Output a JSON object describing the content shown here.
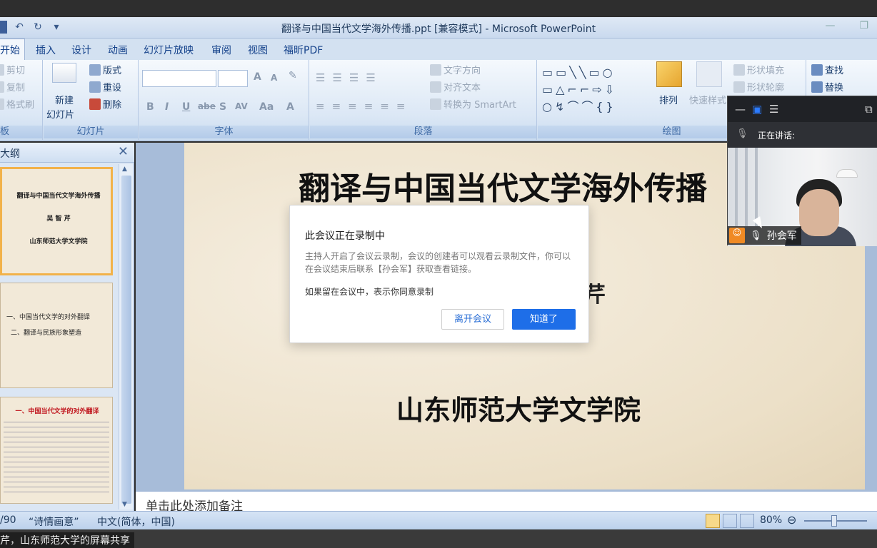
{
  "window": {
    "title": "翻译与中国当代文学海外传播.ppt [兼容模式] - Microsoft PowerPoint"
  },
  "tabs": [
    {
      "label": "开始",
      "active": true
    },
    {
      "label": "插入"
    },
    {
      "label": "设计"
    },
    {
      "label": "动画"
    },
    {
      "label": "幻灯片放映"
    },
    {
      "label": "审阅"
    },
    {
      "label": "视图"
    },
    {
      "label": "福昕PDF"
    }
  ],
  "ribbon": {
    "clipboard": {
      "cut": "剪切",
      "copy": "复制",
      "format_painter": "格式刷",
      "label": "板"
    },
    "slides": {
      "new_slide_1": "新建",
      "new_slide_2": "幻灯片",
      "layout": "版式",
      "reset": "重设",
      "delete": "删除",
      "label": "幻灯片"
    },
    "font": {
      "label": "字体",
      "bold": "B",
      "italic": "I",
      "underline": "U",
      "strike": "abe",
      "shadow": "S",
      "spacing": "AV",
      "case": "Aa",
      "color": "A",
      "grow": "A",
      "shrink": "A"
    },
    "paragraph": {
      "text_direction": "文字方向",
      "align_text": "对齐文本",
      "smartart": "转换为 SmartArt",
      "label": "段落"
    },
    "drawing": {
      "arrange": "排列",
      "quick_styles": "快速样式",
      "shape_fill": "形状填充",
      "shape_outline": "形状轮廓",
      "label": "绘图"
    },
    "editing": {
      "find": "查找",
      "replace": "替换"
    }
  },
  "outline_panel": {
    "tab_label": "大纲",
    "slide1": {
      "line1": "翻译与中国当代文学海外传播",
      "line2": "吴 智 芹",
      "line3": "山东师范大学文学院"
    },
    "slide2": {
      "item1": "一、中国当代文学的对外翻译",
      "item2": "二、翻译与民族形象塑造"
    },
    "slide3": {
      "heading": "一、中国当代文学的对外翻译"
    }
  },
  "slide": {
    "title": "翻译与中国当代文学海外传播",
    "fragment": "芹",
    "organization": "山东师范大学文学院"
  },
  "notes": {
    "placeholder": "单击此处添加备注"
  },
  "statusbar": {
    "slide_count": "/90",
    "theme": "“诗情画意”",
    "language": "中文(简体，中国)",
    "zoom": "80%"
  },
  "screen_share": {
    "caption": "芹，山东师范大学的屏幕共享"
  },
  "meeting": {
    "speaking_label": "正在讲话:",
    "participant_name": "孙会军"
  },
  "dialog": {
    "title": "此会议正在录制中",
    "body": "主持人开启了会议云录制，会议的创建者可以观看云录制文件，你可以在会议结束后联系【孙会军】获取查看链接。",
    "consent": "如果留在会议中，表示你同意录制",
    "leave_button": "离开会议",
    "ok_button": "知道了"
  },
  "colors": {
    "accent": "#1e6ee8",
    "ribbon_bg": "#dbe7f5",
    "slide_bg": "#efe4cf"
  }
}
